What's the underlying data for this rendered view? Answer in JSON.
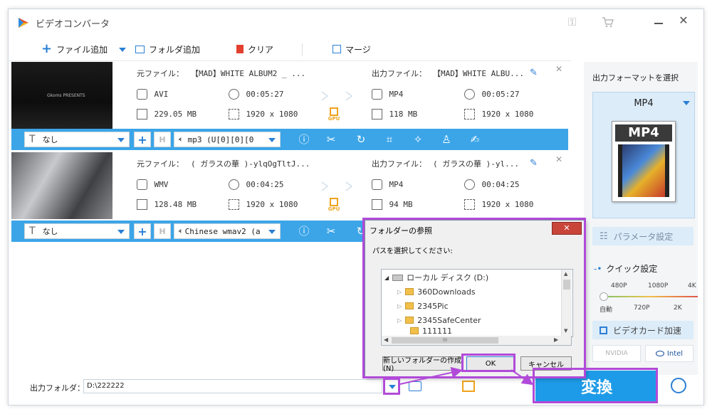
{
  "app": {
    "title": "ビデオコンバータ"
  },
  "toolbar": {
    "add_file": "ファイル追加",
    "add_folder": "フォルダ追加",
    "clear": "クリア",
    "merge": "マージ"
  },
  "files": [
    {
      "source_label": "元ファイル：",
      "source_name": "【MAD】WHITE ALBUM2 _ ...",
      "source_format": "AVI",
      "source_duration": "00:05:27",
      "source_size": "229.05 MB",
      "source_resolution": "1920 x 1080",
      "output_label": "出力ファイル：",
      "output_name": "【MAD】WHITE ALBU...",
      "output_format": "MP4",
      "output_duration": "00:05:27",
      "output_size": "118 MB",
      "output_resolution": "1920 x 1080",
      "thumb_caption": "Gkoms PRESENTS",
      "subtitle": "なし",
      "audio": "mp3 (U[0][0][0"
    },
    {
      "source_label": "元ファイル：",
      "source_name": "( ガラスの華 )-ylqOgTltJ...",
      "source_format": "WMV",
      "source_duration": "00:04:25",
      "source_size": "128.48 MB",
      "source_resolution": "1920 x 1080",
      "output_label": "出力ファイル：",
      "output_name": "( ガラスの華 )-yl...",
      "output_format": "MP4",
      "output_duration": "00:04:25",
      "output_size": "94 MB",
      "output_resolution": "1920 x 1080",
      "thumb_caption": "",
      "subtitle": "なし",
      "audio": "Chinese wmav2 (a"
    }
  ],
  "gpu_badge": "GPU",
  "side": {
    "format_title": "出力フォーマットを選択",
    "format_value": "MP4",
    "format_icon_text": "MP4",
    "param_settings": "パラメータ設定",
    "quick_settings": "クイック設定",
    "quality_top": [
      "480P",
      "1080P",
      "4K"
    ],
    "quality_bottom": [
      "自動",
      "720P",
      "2K"
    ],
    "gpu_accel": "ビデオカード加速",
    "nvidia": "NVIDIA",
    "intel": "Intel"
  },
  "bottom": {
    "output_folder_label": "出力フォルダ：",
    "output_folder_value": "D:\\222222",
    "convert": "変換"
  },
  "dialog": {
    "title": "フォルダーの参照",
    "prompt": "パスを選択してください:",
    "tree": [
      "ローカル ディスク (D:)",
      "360Downloads",
      "2345Pic",
      "2345SafeCenter",
      "111111"
    ],
    "new_folder": "新しいフォルダーの作成(N)",
    "ok": "OK",
    "cancel": "キャンセル",
    "scroll_mid": "III"
  },
  "colors": {
    "accent": "#3ba5e8",
    "highlight": "#b14ad9",
    "convert_bg": "#1e9be8"
  }
}
